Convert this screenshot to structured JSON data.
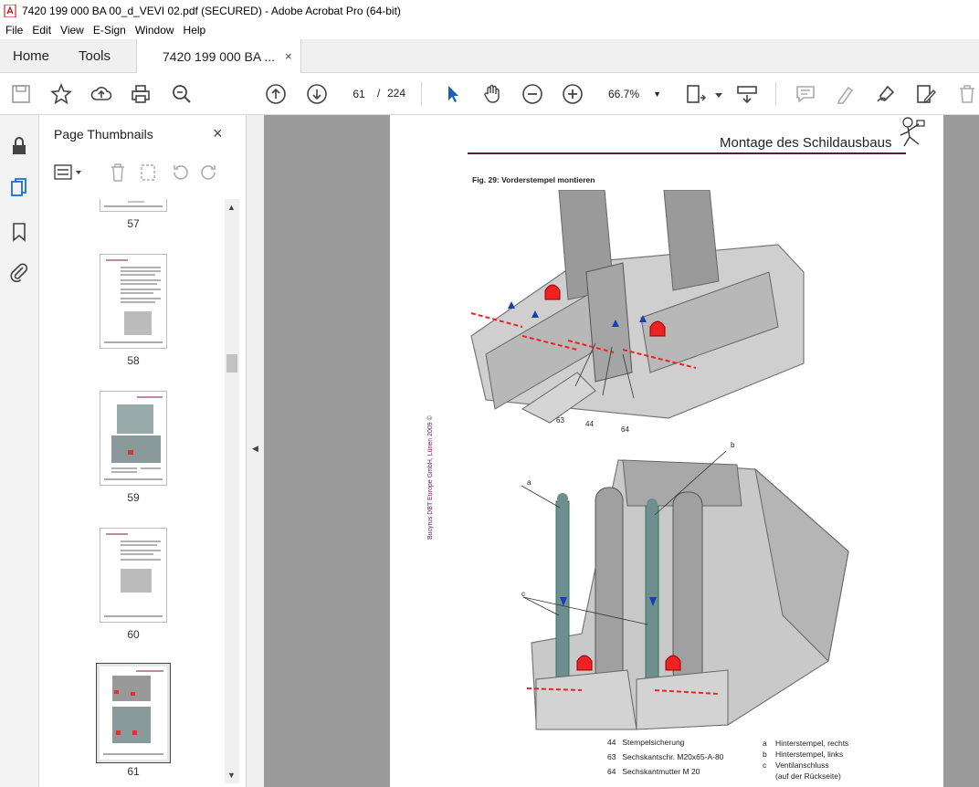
{
  "window": {
    "title": "7420 199 000 BA 00_d_VEVI 02.pdf (SECURED) - Adobe Acrobat Pro (64-bit)"
  },
  "menu": [
    "File",
    "Edit",
    "View",
    "E-Sign",
    "Window",
    "Help"
  ],
  "tabs": {
    "home": "Home",
    "tools": "Tools",
    "document": "7420 199 000 BA ...",
    "close": "×"
  },
  "toolbar": {
    "page_current": "61",
    "page_sep": "/",
    "page_total": "224",
    "zoom": "66.7%"
  },
  "panel": {
    "title": "Page Thumbnails",
    "close": "×"
  },
  "thumbnails": [
    {
      "label": "57"
    },
    {
      "label": "58"
    },
    {
      "label": "59"
    },
    {
      "label": "60"
    },
    {
      "label": "61"
    }
  ],
  "page": {
    "header": "Montage des Schildausbaus",
    "figure_caption": "Fig. 29:   Vorderstempel montieren",
    "side_copyright": "Bucyrus DBT Europe GmbH, Lünen 2009 ©",
    "callouts": {
      "c63": "63",
      "c44": "44",
      "c64": "64",
      "ca": "a",
      "cb": "b",
      "cc": "c"
    },
    "legend_left": [
      {
        "num": "44",
        "text": "Stempelsicherung"
      },
      {
        "num": "63",
        "text": "Sechskantschr. M20x65-A-80"
      },
      {
        "num": "64",
        "text": "Sechskantmutter M 20"
      }
    ],
    "legend_right": [
      {
        "num": "a",
        "text": "Hinterstempel, rechts"
      },
      {
        "num": "b",
        "text": "Hinterstempel, links"
      },
      {
        "num": "c",
        "text": "Ventilanschluss"
      },
      {
        "num": "",
        "text": "(auf der Rückseite)"
      }
    ]
  }
}
